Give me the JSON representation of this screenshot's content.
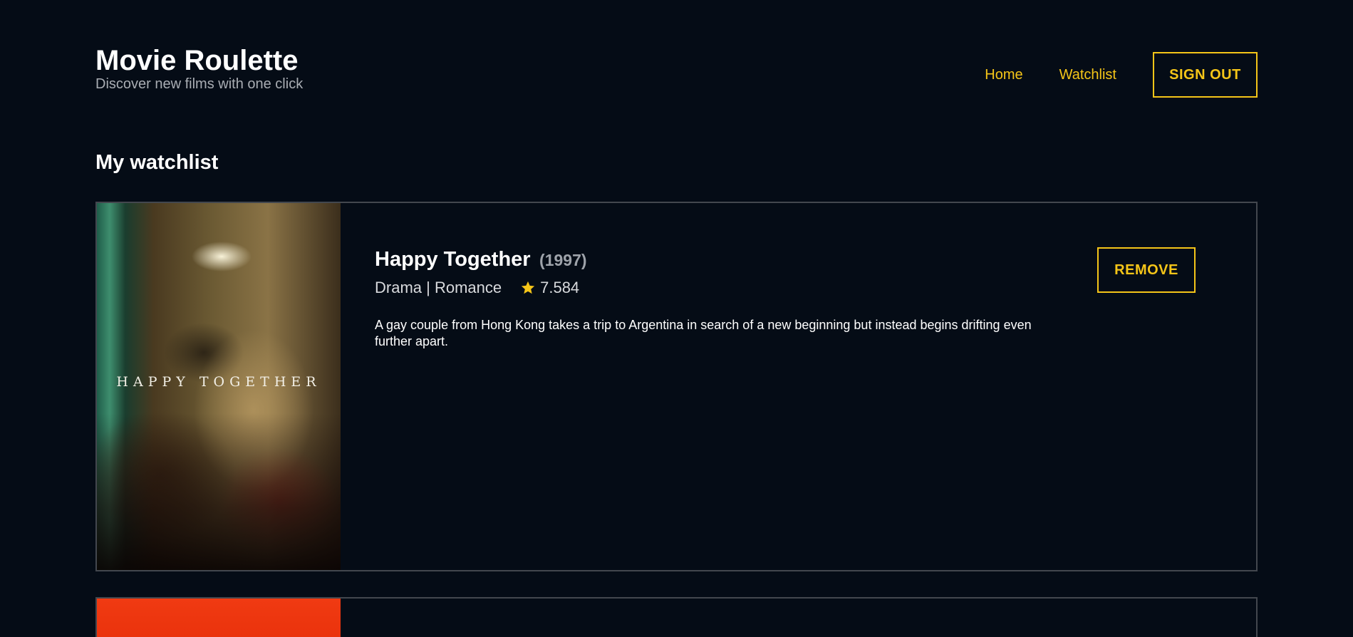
{
  "header": {
    "title": "Movie Roulette",
    "subtitle": "Discover new films with one click",
    "nav": {
      "home_label": "Home",
      "watchlist_label": "Watchlist",
      "signout_label": "SIGN OUT"
    }
  },
  "main": {
    "section_title": "My watchlist",
    "movies": [
      {
        "title": "Happy Together",
        "year": "(1997)",
        "genres": "Drama | Romance",
        "rating": "7.584",
        "rating_icon": "star-icon",
        "overview": "A gay couple from Hong Kong takes a trip to Argentina in search of a new beginning but instead begins drifting even further apart.",
        "poster_text": "HAPPY TOGETHER",
        "remove_label": "REMOVE"
      }
    ]
  },
  "colors": {
    "background": "#050c16",
    "accent": "#f5c518",
    "card_border": "#43474e",
    "muted_text": "#a9adb3"
  }
}
